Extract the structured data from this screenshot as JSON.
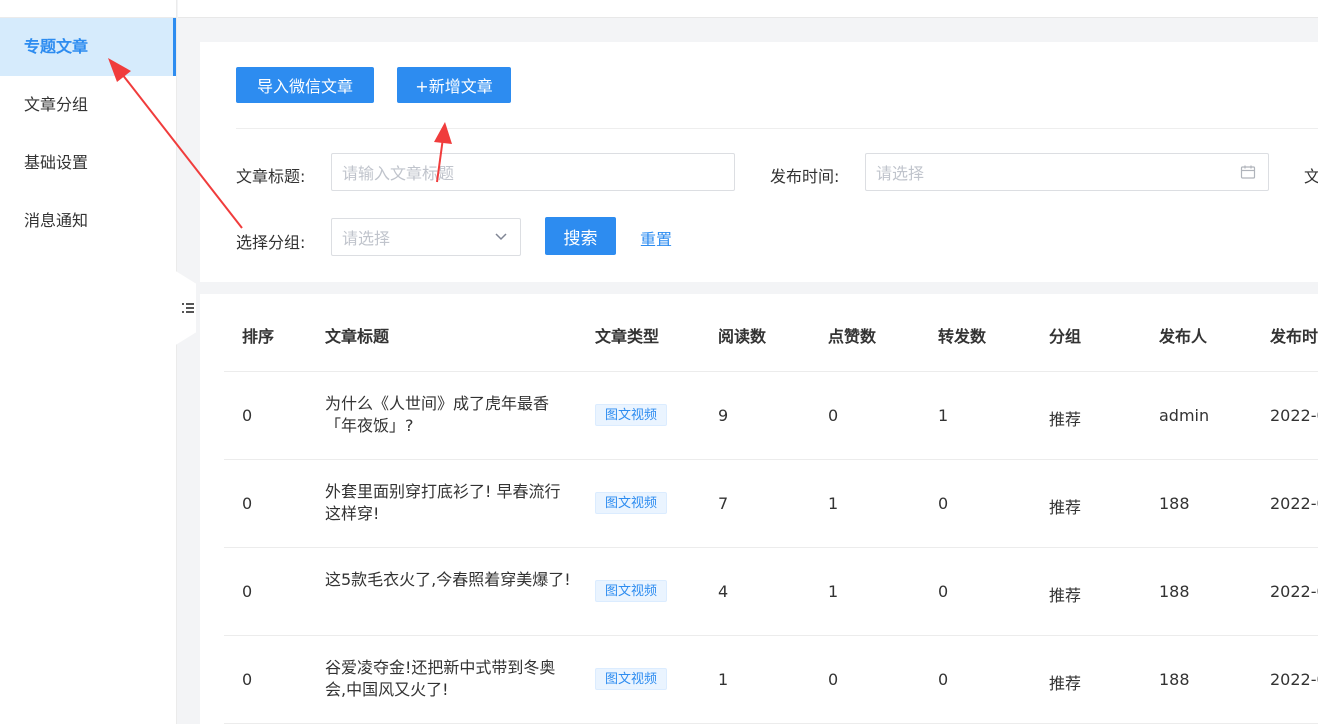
{
  "sidebar": {
    "items": [
      {
        "label": "专题文章",
        "active": true
      },
      {
        "label": "文章分组",
        "active": false
      },
      {
        "label": "基础设置",
        "active": false
      },
      {
        "label": "消息通知",
        "active": false
      }
    ]
  },
  "toolbar": {
    "import_label": "导入微信文章",
    "add_label": "+新增文章"
  },
  "filters": {
    "title_label": "文章标题:",
    "title_placeholder": "请输入文章标题",
    "time_label": "发布时间:",
    "time_placeholder": "请选择",
    "type_label_partial": "文",
    "group_label": "选择分组:",
    "group_placeholder": "请选择",
    "search_label": "搜索",
    "reset_label": "重置"
  },
  "table": {
    "headers": [
      "排序",
      "文章标题",
      "文章类型",
      "阅读数",
      "点赞数",
      "转发数",
      "分组",
      "发布人",
      "发布时"
    ],
    "rows": [
      {
        "order": "0",
        "title": "为什么《人世间》成了虎年最香「年夜饭」?",
        "type": "图文视频",
        "reads": "9",
        "likes": "0",
        "shares": "1",
        "group": "推荐",
        "author": "admin",
        "time": "2022-0"
      },
      {
        "order": "0",
        "title": "外套里面别穿打底衫了! 早春流行这样穿!",
        "type": "图文视频",
        "reads": "7",
        "likes": "1",
        "shares": "0",
        "group": "推荐",
        "author": "188",
        "time": "2022-0"
      },
      {
        "order": "0",
        "title": "这5款毛衣火了,今春照着穿美爆了!",
        "type": "图文视频",
        "reads": "4",
        "likes": "1",
        "shares": "0",
        "group": "推荐",
        "author": "188",
        "time": "2022-0"
      },
      {
        "order": "0",
        "title": "谷爱凌夺金!还把新中式带到冬奥会,中国风又火了!",
        "type": "图文视频",
        "reads": "1",
        "likes": "0",
        "shares": "0",
        "group": "推荐",
        "author": "188",
        "time": "2022-0"
      }
    ]
  },
  "colors": {
    "accent": "#2d8cf0",
    "active_bg": "#d6ebfc",
    "annotation_arrow": "#f03c3c"
  }
}
